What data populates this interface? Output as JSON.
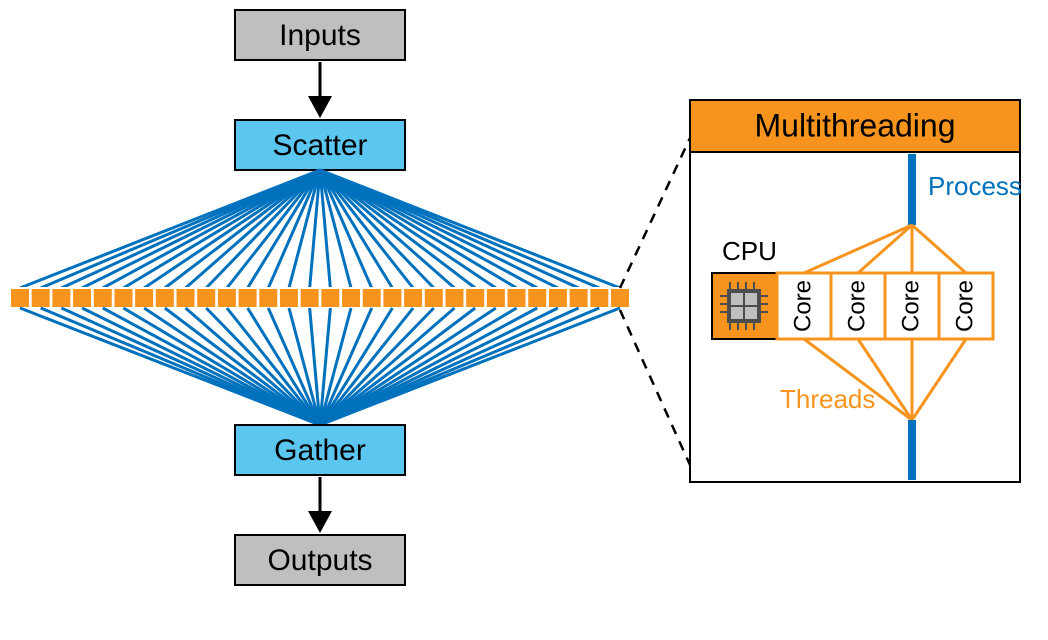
{
  "main": {
    "inputs_label": "Inputs",
    "scatter_label": "Scatter",
    "gather_label": "Gather",
    "outputs_label": "Outputs"
  },
  "detail": {
    "header": "Multithreading",
    "process_label": "Process",
    "cpu_label": "CPU",
    "threads_label": "Threads",
    "core_label": "Core",
    "num_cores": 4
  },
  "diagram": {
    "num_task_squares": 30
  },
  "colors": {
    "gray": "#bfbfbf",
    "blue_fill": "#5bc6f0",
    "orange": "#f7941d",
    "blue_line": "#0071bc"
  }
}
